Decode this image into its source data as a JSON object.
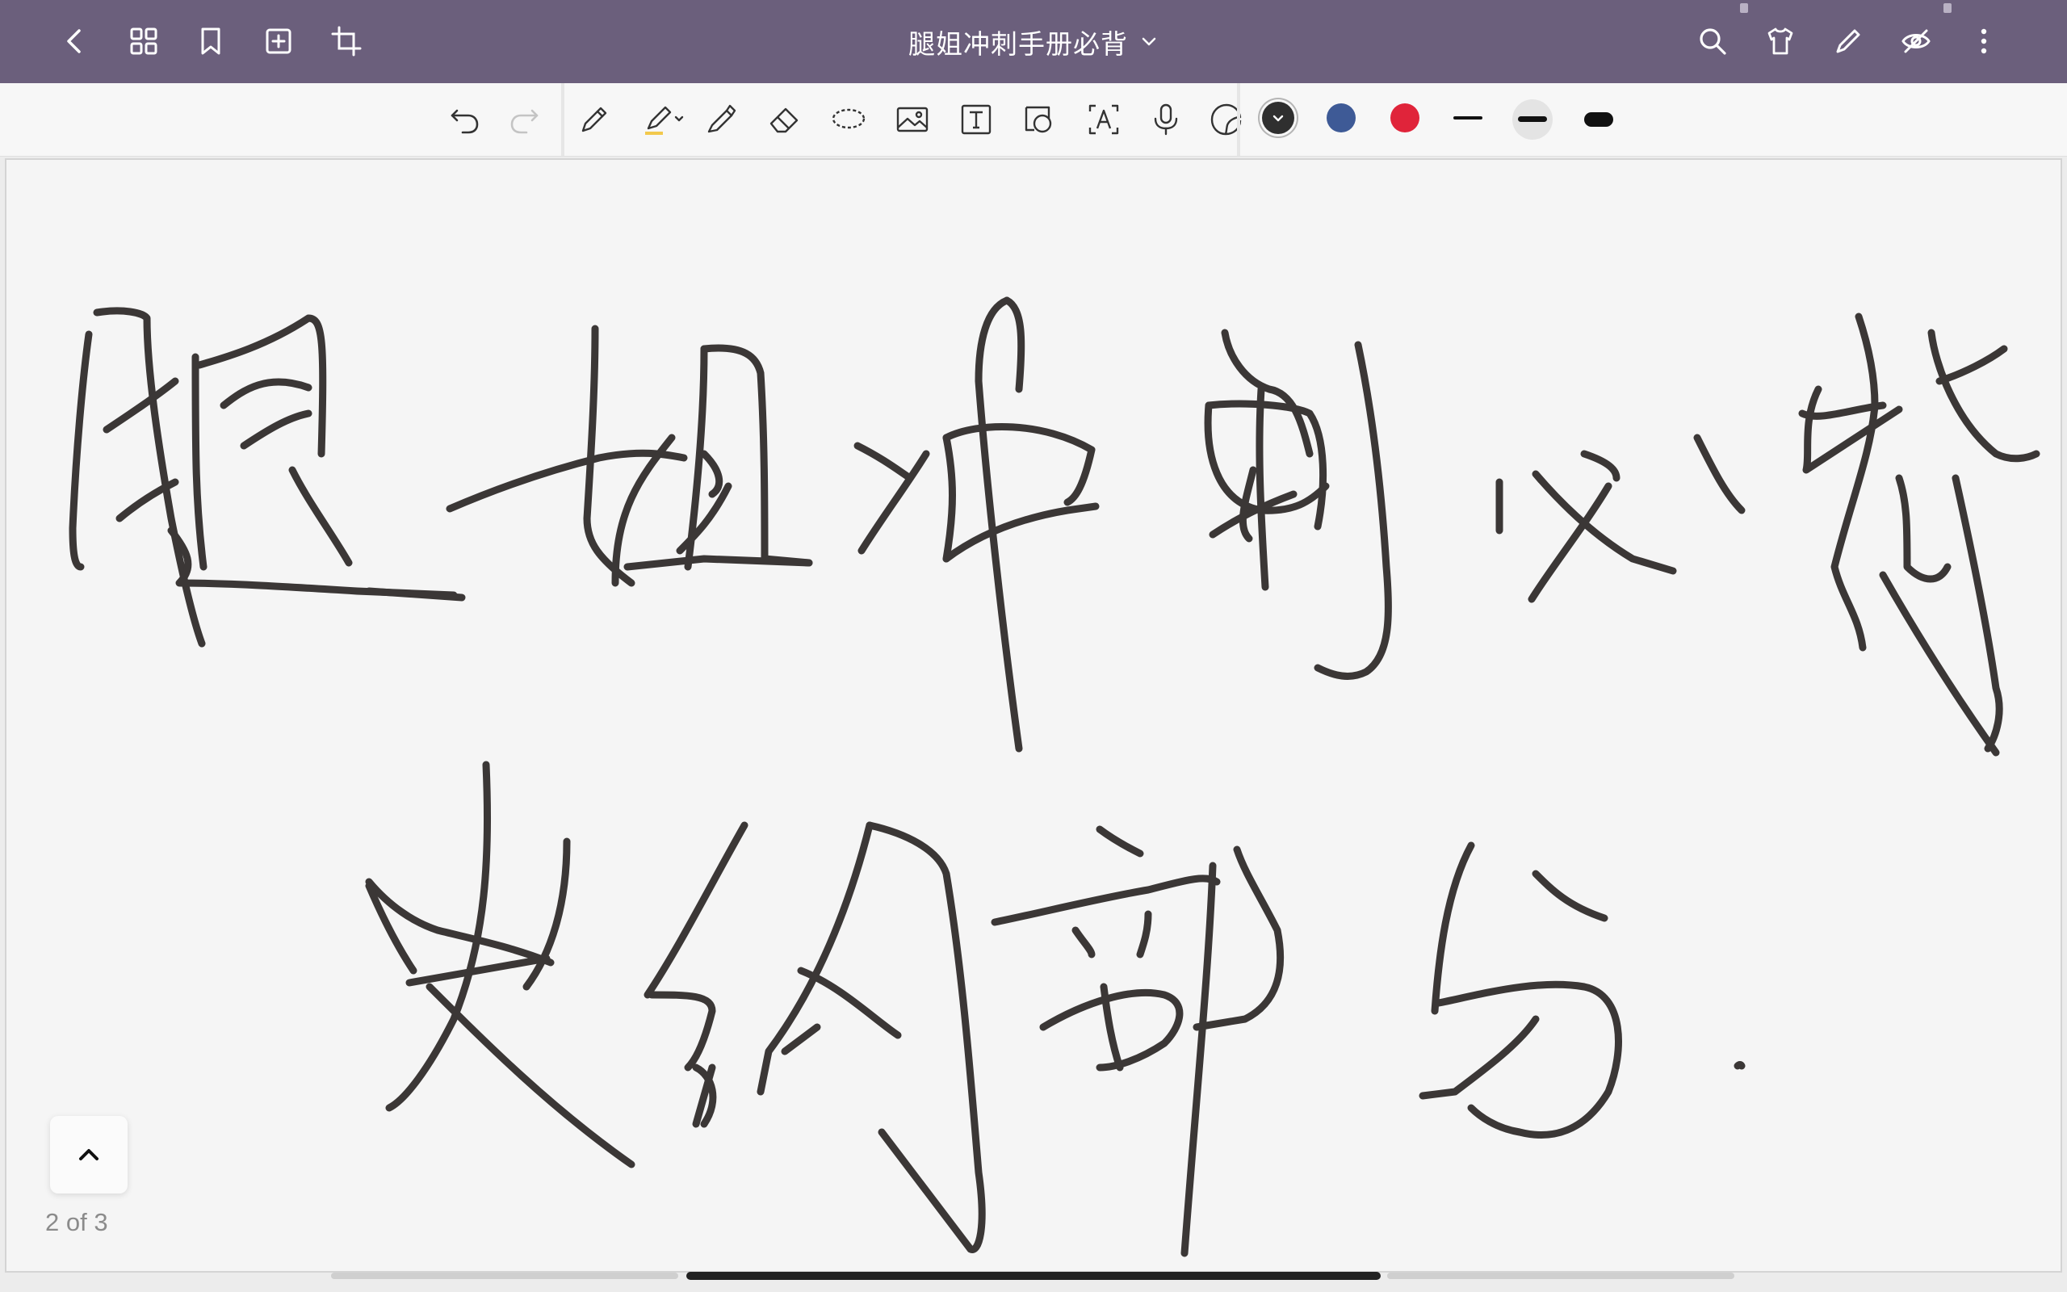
{
  "title_bar": {
    "document_title": "腿姐冲刺手册必背",
    "icons": [
      "back-icon",
      "grid-icon",
      "bookmark-icon",
      "add-page-icon",
      "crop-icon",
      "search-icon",
      "shirt-icon",
      "pen-icon",
      "eye-off-icon",
      "more-icon"
    ]
  },
  "toolbar": {
    "tools": [
      "undo-icon",
      "redo-icon",
      "pen-tool-icon",
      "highlighter-tool-icon",
      "marker-tool-icon",
      "eraser-tool-icon",
      "lasso-tool-icon",
      "image-tool-icon",
      "text-tool-icon",
      "shape-tool-icon",
      "text-recognition-icon",
      "microphone-icon",
      "sticker-icon"
    ],
    "colors": [
      "#2f2f2f",
      "#3e5a96",
      "#e0243a"
    ],
    "selected_color": "#2f2f2f",
    "stroke_sizes": [
      "thin",
      "medium",
      "thick"
    ],
    "selected_stroke": "medium"
  },
  "canvas": {
    "ink_color": "#3b3736"
  },
  "pagination": {
    "label": "2 of 3",
    "current_page": 2,
    "total_pages": 3
  },
  "scroll": {
    "position": 0.5
  }
}
